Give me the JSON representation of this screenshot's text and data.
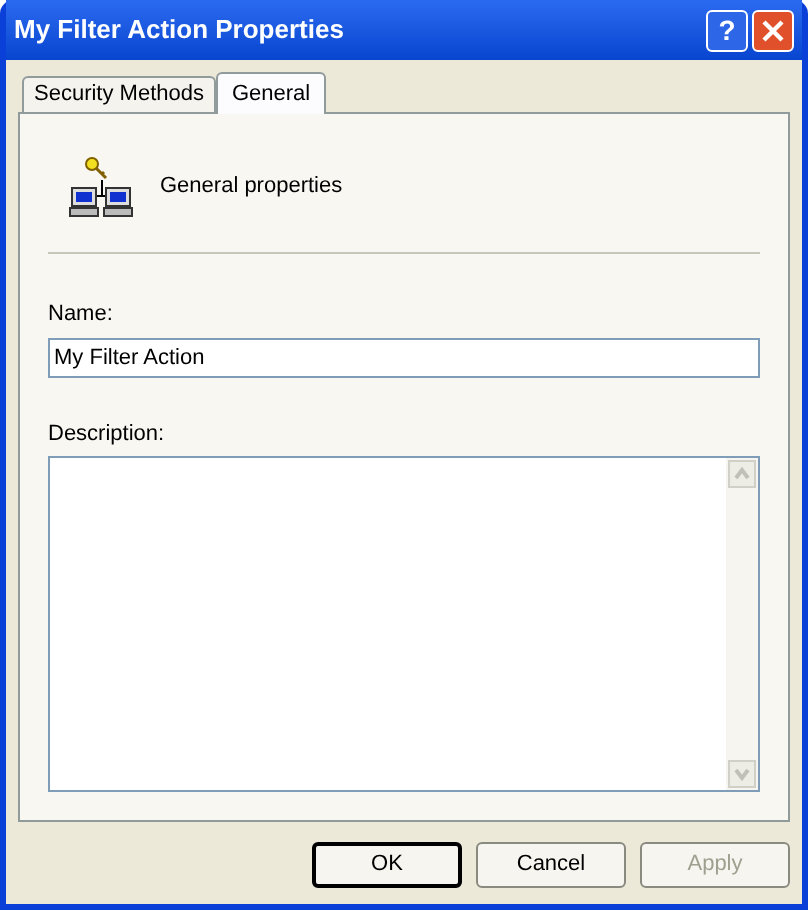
{
  "window": {
    "title": "My Filter Action Properties"
  },
  "title_buttons": [
    {
      "kind": "help",
      "label": "?"
    },
    {
      "kind": "close"
    }
  ],
  "tabs": [
    {
      "label": "Security Methods",
      "selected": false
    },
    {
      "label": "General",
      "selected": true
    }
  ],
  "header": {
    "text": "General properties"
  },
  "name_field": {
    "label": "Name:",
    "value": "My Filter Action"
  },
  "description_field": {
    "label": "Description:"
  },
  "buttons": [
    {
      "label": "OK",
      "default": true,
      "disabled": false
    },
    {
      "label": "Cancel",
      "default": false,
      "disabled": false
    },
    {
      "label": "Apply",
      "default": false,
      "disabled": true
    }
  ]
}
